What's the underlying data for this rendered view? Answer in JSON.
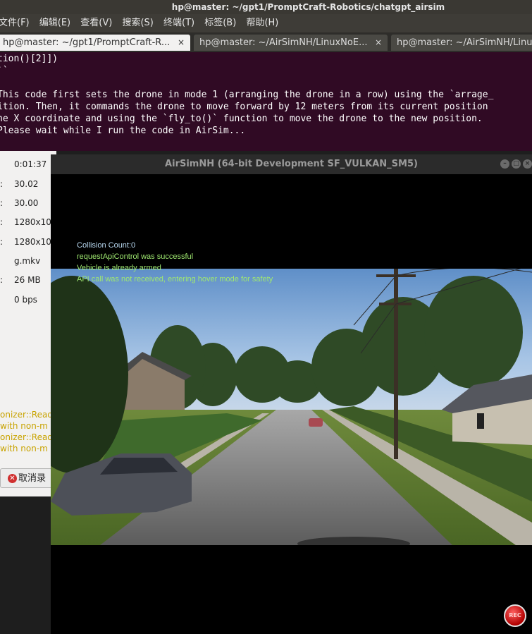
{
  "terminal": {
    "title": "hp@master: ~/gpt1/PromptCraft-Robotics/chatgpt_airsim",
    "menu": [
      "文件(F)",
      "编辑(E)",
      "查看(V)",
      "搜索(S)",
      "终端(T)",
      "标签(B)",
      "帮助(H)"
    ],
    "tabs": [
      {
        "label": "hp@master: ~/gpt1/PromptCraft-R...",
        "close": "×"
      },
      {
        "label": "hp@master: ~/AirSimNH/LinuxNoE...",
        "close": "×"
      },
      {
        "label": "hp@master: ~/AirSimNH/Linux",
        "close": ""
      }
    ],
    "lines": [
      "tion()[2]])",
      "``",
      "",
      "This code first sets the drone in mode 1 (arranging the drone in a row) using the `arrage_",
      "ition. Then, it commands the drone to move forward by 12 meters from its current position",
      "he X coordinate and using the `fly_to()` function to move the drone to the new position.",
      "Please wait while I run the code in AirSim..."
    ]
  },
  "properties": {
    "rows": [
      {
        "prefix": "",
        "value": "0:01:37"
      },
      {
        "prefix": ":",
        "value": "30.02"
      },
      {
        "prefix": ":",
        "value": "30.00"
      },
      {
        "prefix": ":",
        "value": "1280x10"
      },
      {
        "prefix": ":",
        "value": "1280x10"
      },
      {
        "prefix": "",
        "value": "g.mkv"
      },
      {
        "prefix": ":",
        "value": "26 MB"
      },
      {
        "prefix": "",
        "value": "0 bps"
      }
    ],
    "warnings": [
      "onizer::Read",
      " with non-m",
      "onizer::Read",
      " with non-m"
    ],
    "cancel_label": "取消录"
  },
  "airsim": {
    "title": "AirSimNH (64-bit Development SF_VULKAN_SM5)",
    "overlay": [
      {
        "text": "Collision Count:0",
        "color": "#b8d8f0"
      },
      {
        "text": "requestApiControl was successful",
        "color": "#9fe870"
      },
      {
        "text": "Vehicle is already armed",
        "color": "#9fe870"
      },
      {
        "text": "API call was not received, entering hover mode for safety",
        "color": "#9fe870"
      }
    ],
    "rec_label": "REC"
  }
}
